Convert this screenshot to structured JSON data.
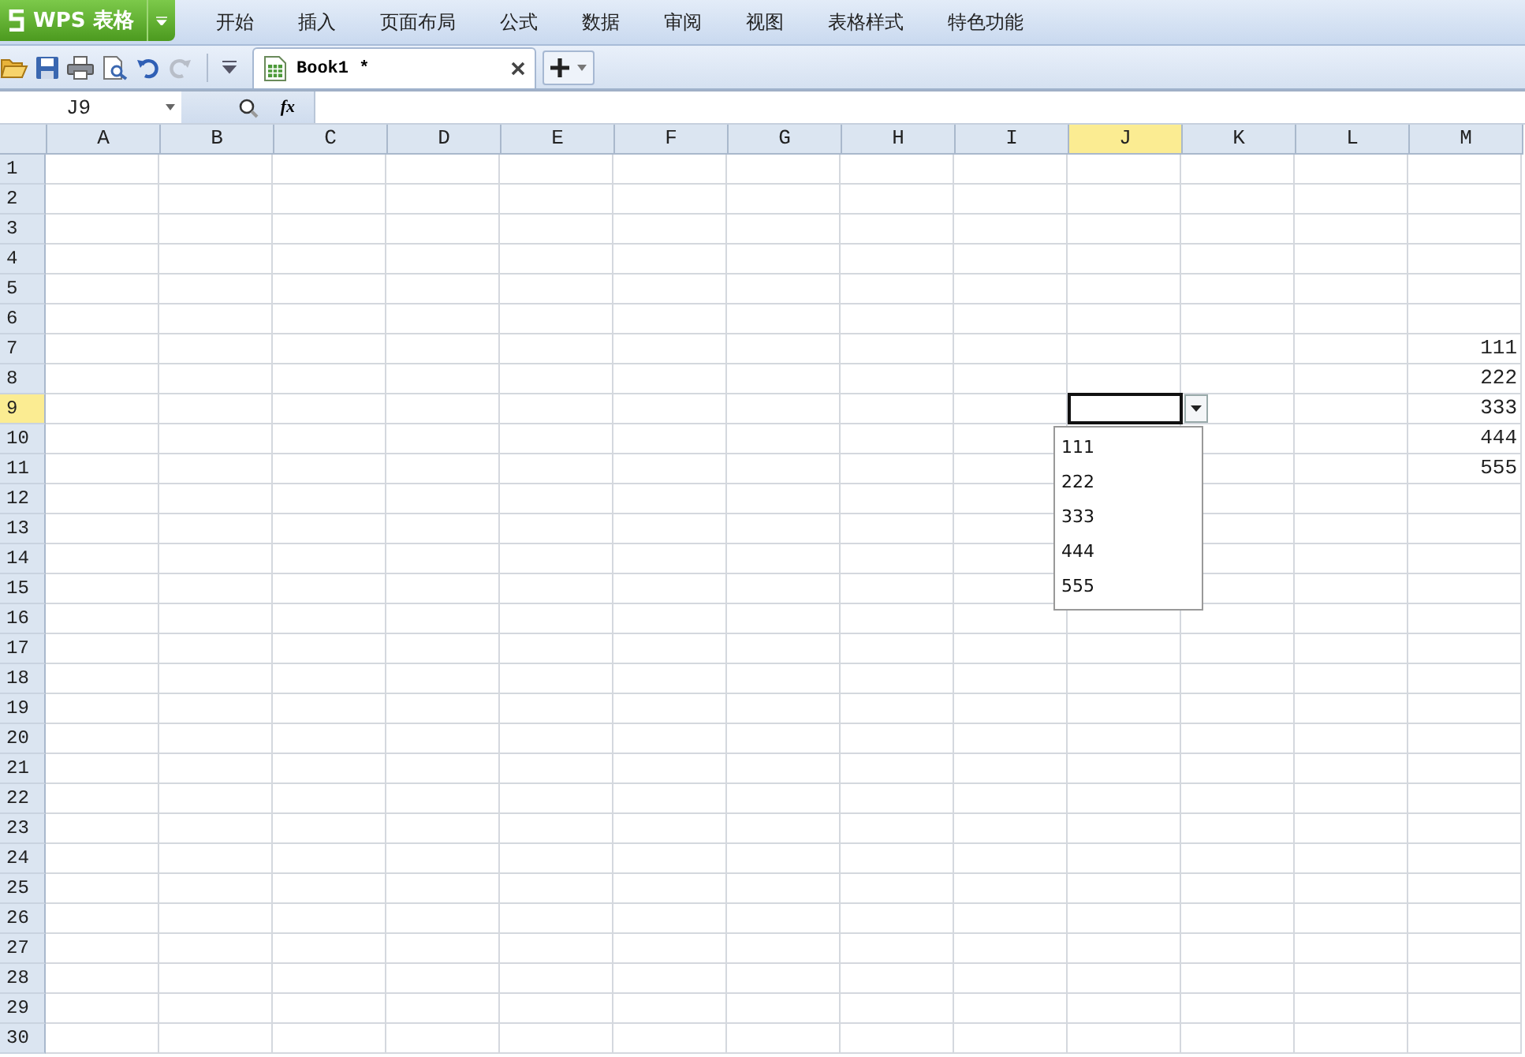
{
  "app_button": {
    "label": "WPS 表格"
  },
  "menu_tabs": [
    {
      "label": "开始",
      "selected": false
    },
    {
      "label": "插入",
      "selected": false
    },
    {
      "label": "页面布局",
      "selected": false
    },
    {
      "label": "公式",
      "selected": false
    },
    {
      "label": "数据",
      "selected": false
    },
    {
      "label": "审阅",
      "selected": false
    },
    {
      "label": "视图",
      "selected": false
    },
    {
      "label": "表格样式",
      "selected": false
    },
    {
      "label": "特色功能",
      "selected": false
    }
  ],
  "document_tabs": [
    {
      "label": "Book1 *",
      "selected": true
    }
  ],
  "formula_bar": {
    "name_box": "J9",
    "fx": "fx"
  },
  "columns": [
    {
      "label": "A",
      "selected": false
    },
    {
      "label": "B",
      "selected": false
    },
    {
      "label": "C",
      "selected": false
    },
    {
      "label": "D",
      "selected": false
    },
    {
      "label": "E",
      "selected": false
    },
    {
      "label": "F",
      "selected": false
    },
    {
      "label": "G",
      "selected": false
    },
    {
      "label": "H",
      "selected": false
    },
    {
      "label": "I",
      "selected": false
    },
    {
      "label": "J",
      "selected": true
    },
    {
      "label": "K",
      "selected": false
    },
    {
      "label": "L",
      "selected": false
    },
    {
      "label": "M",
      "selected": false
    }
  ],
  "rows": [
    {
      "label": "1",
      "selected": false
    },
    {
      "label": "2",
      "selected": false
    },
    {
      "label": "3",
      "selected": false
    },
    {
      "label": "4",
      "selected": false
    },
    {
      "label": "5",
      "selected": false
    },
    {
      "label": "6",
      "selected": false
    },
    {
      "label": "7",
      "selected": false,
      "cells": [
        null,
        null,
        null,
        null,
        null,
        null,
        null,
        null,
        null,
        null,
        null,
        null,
        "111"
      ]
    },
    {
      "label": "8",
      "selected": false,
      "cells": [
        null,
        null,
        null,
        null,
        null,
        null,
        null,
        null,
        null,
        null,
        null,
        null,
        "222"
      ]
    },
    {
      "label": "9",
      "selected": true,
      "cells": [
        null,
        null,
        null,
        null,
        null,
        null,
        null,
        null,
        null,
        null,
        null,
        null,
        "333"
      ]
    },
    {
      "label": "10",
      "selected": false,
      "cells": [
        null,
        null,
        null,
        null,
        null,
        null,
        null,
        null,
        null,
        null,
        null,
        null,
        "444"
      ]
    },
    {
      "label": "11",
      "selected": false,
      "cells": [
        null,
        null,
        null,
        null,
        null,
        null,
        null,
        null,
        null,
        null,
        null,
        null,
        "555"
      ]
    },
    {
      "label": "12",
      "selected": false
    },
    {
      "label": "13",
      "selected": false
    },
    {
      "label": "14",
      "selected": false
    },
    {
      "label": "15",
      "selected": false
    },
    {
      "label": "16",
      "selected": false
    },
    {
      "label": "17",
      "selected": false
    },
    {
      "label": "18",
      "selected": false
    },
    {
      "label": "19",
      "selected": false
    },
    {
      "label": "20",
      "selected": false
    },
    {
      "label": "21",
      "selected": false
    },
    {
      "label": "22",
      "selected": false
    },
    {
      "label": "23",
      "selected": false
    },
    {
      "label": "24",
      "selected": false
    },
    {
      "label": "25",
      "selected": false
    },
    {
      "label": "26",
      "selected": false
    },
    {
      "label": "27",
      "selected": false
    },
    {
      "label": "28",
      "selected": false
    },
    {
      "label": "29",
      "selected": false
    },
    {
      "label": "30",
      "selected": false
    }
  ],
  "validation_dropdown": {
    "options": [
      "111",
      "222",
      "333",
      "444",
      "555"
    ]
  }
}
